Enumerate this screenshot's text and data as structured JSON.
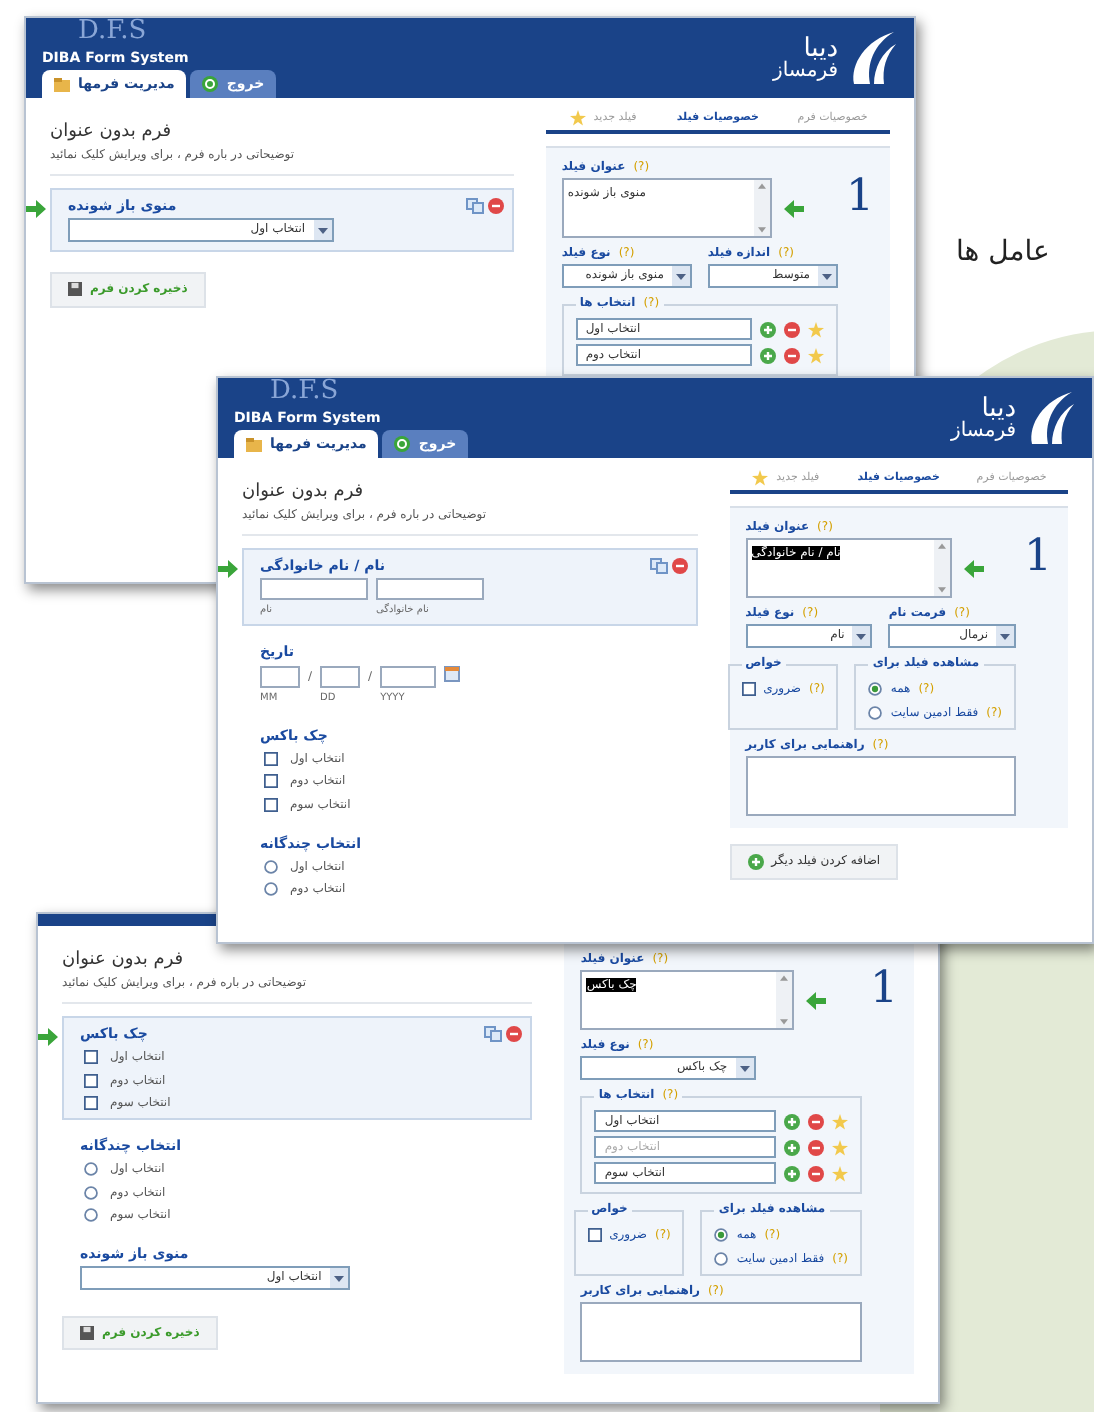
{
  "page_heading": "عامل ها",
  "windows": [
    {
      "header": {
        "watermark": "D.F.S",
        "system_name": "DIBA Form System",
        "logo_title": "دیبا",
        "logo_subtitle": "فرمساز",
        "tabs": [
          {
            "label": "خروج",
            "selected": false
          },
          {
            "label": "مدیریت فرمها",
            "selected": true
          }
        ]
      },
      "property_tabs": [
        {
          "label": "خصوصیات فرم",
          "kind": "plain",
          "selected": false
        },
        {
          "label": "خصوصیات فیلد",
          "kind": "plain",
          "selected": true
        },
        {
          "label": "فیلد جدید",
          "kind": "new",
          "selected": false
        }
      ],
      "form": {
        "title": "فرم بدون عنوان",
        "description": "توضیحاتی در باره فرم ، برای ویرایش کلیک نمائید"
      },
      "fields": [
        {
          "kind": "dropdown",
          "label": "منوی باز شونده",
          "value": "انتخاب اول",
          "active": true
        }
      ],
      "save_button": "ذخیره کردن فرم",
      "field_number": "1",
      "properties": [
        {
          "kind": "textarea",
          "label": "عنوان فیلد",
          "help": "(?)",
          "value": "منوی باز شونده",
          "highlighted": false
        },
        {
          "kind": "selects",
          "items": [
            {
              "label": "اندازه فیلد",
              "help": "(?)",
              "value": "متوسط"
            },
            {
              "label": "نوع فیلد",
              "help": "(?)",
              "value": "منوی باز شونده"
            }
          ]
        },
        {
          "kind": "choices",
          "label": "انتخاب ها",
          "help": "(?)",
          "options": [
            {
              "value": "انتخاب اول"
            },
            {
              "value": "انتخاب دوم"
            }
          ]
        }
      ]
    },
    {
      "header": {
        "watermark": "D.F.S",
        "system_name": "DIBA Form System",
        "logo_title": "دیبا",
        "logo_subtitle": "فرمساز",
        "tabs": [
          {
            "label": "خروج",
            "selected": false
          },
          {
            "label": "مدیریت فرمها",
            "selected": true
          }
        ]
      },
      "property_tabs": [
        {
          "label": "خصوصیات فرم",
          "kind": "plain",
          "selected": false
        },
        {
          "label": "خصوصیات فیلد",
          "kind": "plain",
          "selected": true
        },
        {
          "label": "فیلد جدید",
          "kind": "new",
          "selected": false
        }
      ],
      "form": {
        "title": "فرم بدون عنوان",
        "description": "توضیحاتی در باره فرم ، برای ویرایش کلیک نمائید"
      },
      "fields": [
        {
          "kind": "name",
          "label": "نام / نام خانوادگی",
          "captions": [
            "نام خانوادگی",
            "نام"
          ],
          "active": true
        },
        {
          "kind": "date",
          "label": "تاریخ",
          "separator": "/",
          "captions": [
            "YYYY",
            "DD",
            "MM"
          ],
          "active": false
        },
        {
          "kind": "checkboxes",
          "label": "چک باکس",
          "options": [
            {
              "label": "انتخاب اول",
              "checked": false
            },
            {
              "label": "انتخاب دوم",
              "checked": false
            },
            {
              "label": "انتخاب سوم",
              "checked": false
            }
          ],
          "active": false
        },
        {
          "kind": "radios",
          "label": "انتخاب چندگانه",
          "options": [
            {
              "label": "انتخاب اول",
              "selected": false
            },
            {
              "label": "انتخاب دوم",
              "selected": false
            }
          ],
          "active": false
        }
      ],
      "field_number": "1",
      "properties": [
        {
          "kind": "textarea",
          "label": "عنوان فیلد",
          "help": "(?)",
          "value": "نام / نام خانوادگی",
          "highlighted": true
        },
        {
          "kind": "selects",
          "items": [
            {
              "label": "فرمت نام",
              "help": "(?)",
              "value": "نرمال"
            },
            {
              "label": "نوع فیلد",
              "help": "(?)",
              "value": "نام"
            }
          ]
        },
        {
          "kind": "settings",
          "groups": [
            {
              "kind": "radios",
              "title": "مشاهده فیلد برای",
              "items": [
                {
                  "label": "همه",
                  "help": "(?)",
                  "selected": true
                },
                {
                  "label": "فقط ادمین سایت",
                  "help": "(?)",
                  "selected": false
                }
              ]
            },
            {
              "kind": "checkboxes",
              "title": "خواص",
              "items": [
                {
                  "label": "ضروری",
                  "help": "(?)",
                  "checked": false
                }
              ]
            }
          ]
        },
        {
          "kind": "help_box",
          "label": "راهنمایی برای کاربر",
          "help": "(?)"
        }
      ],
      "add_field_button": "اضافه کردن فیلد دیگر"
    },
    {
      "form": {
        "title": "فرم بدون عنوان",
        "description": "توضیحاتی در باره فرم ، برای ویرایش کلیک نمائید"
      },
      "fields": [
        {
          "kind": "checkboxes",
          "label": "چک باکس",
          "options": [
            {
              "label": "انتخاب اول",
              "checked": false
            },
            {
              "label": "انتخاب دوم",
              "checked": false
            },
            {
              "label": "انتخاب سوم",
              "checked": false
            }
          ],
          "active": true
        },
        {
          "kind": "radios",
          "label": "انتخاب چندگانه",
          "options": [
            {
              "label": "انتخاب اول",
              "selected": false
            },
            {
              "label": "انتخاب دوم",
              "selected": false
            },
            {
              "label": "انتخاب سوم",
              "selected": false
            }
          ],
          "active": false
        },
        {
          "kind": "dropdown",
          "label": "منوی باز شونده",
          "value": "انتخاب اول",
          "active": false
        }
      ],
      "save_button": "ذخیره کردن فرم",
      "field_number": "1",
      "properties": [
        {
          "kind": "textarea",
          "label": "عنوان فیلد",
          "help": "(?)",
          "value": "چک باکس",
          "highlighted": true
        },
        {
          "kind": "selects",
          "items": [
            {
              "label": "نوع فیلد",
              "help": "(?)",
              "value": "چک باکس"
            }
          ]
        },
        {
          "kind": "choices",
          "label": "انتخاب ها",
          "help": "(?)",
          "options": [
            {
              "value": "انتخاب اول"
            },
            {
              "placeholder": "انتخاب دوم"
            },
            {
              "value": "انتخاب سوم"
            }
          ]
        },
        {
          "kind": "settings",
          "groups": [
            {
              "kind": "radios",
              "title": "مشاهده فیلد برای",
              "items": [
                {
                  "label": "همه",
                  "help": "(?)",
                  "selected": true
                },
                {
                  "label": "فقط ادمین سایت",
                  "help": "(?)",
                  "selected": false
                }
              ]
            },
            {
              "kind": "checkboxes",
              "title": "خواص",
              "items": [
                {
                  "label": "ضروری",
                  "help": "(?)",
                  "checked": false
                }
              ]
            }
          ]
        },
        {
          "kind": "help_box",
          "label": "راهنمایی برای کاربر",
          "help": "(?)"
        }
      ]
    }
  ]
}
